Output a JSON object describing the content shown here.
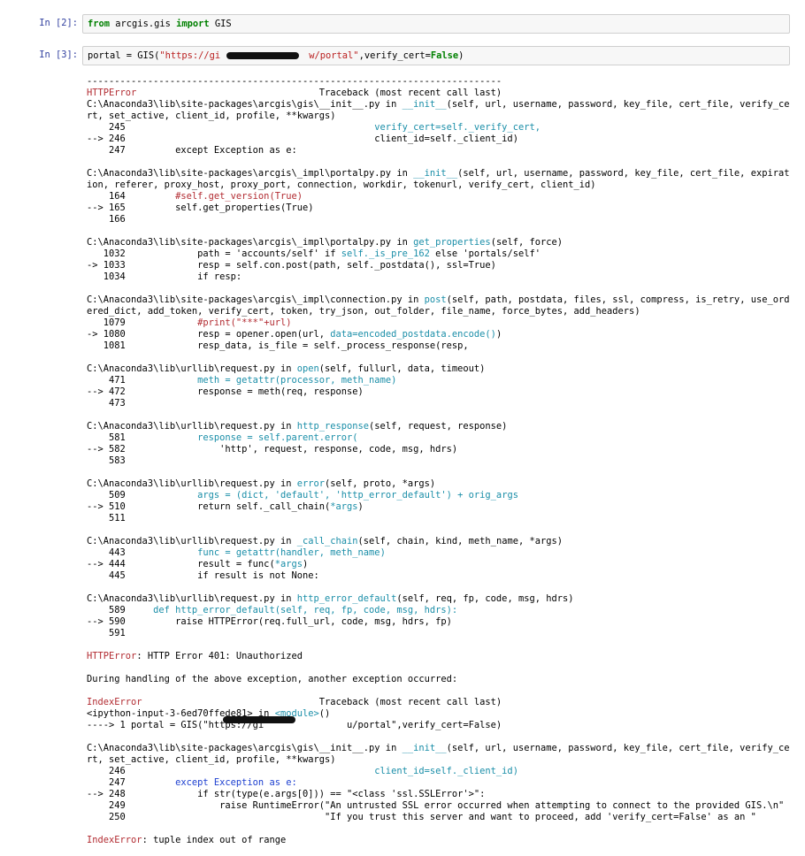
{
  "cells": [
    {
      "prompt": "In [2]:",
      "code_parts": [
        {
          "t": "from",
          "c": "kw"
        },
        {
          "t": " arcgis.gis ",
          "c": ""
        },
        {
          "t": "import",
          "c": "kw"
        },
        {
          "t": " GIS",
          "c": ""
        }
      ]
    },
    {
      "prompt": "In [3]:",
      "code_parts": [
        {
          "t": "portal = GIS(",
          "c": ""
        },
        {
          "t": "\"https://gi",
          "c": "str"
        },
        {
          "t": "                ",
          "c": "str"
        },
        {
          "t": "w/portal\"",
          "c": "str"
        },
        {
          "t": ",verify_cert=",
          "c": ""
        },
        {
          "t": "False",
          "c": "kw"
        },
        {
          "t": ")",
          "c": ""
        }
      ]
    }
  ],
  "output_lines": [
    [
      {
        "t": "---------------------------------------------------------------------------",
        "c": ""
      }
    ],
    [
      {
        "t": "HTTPError",
        "c": "red"
      },
      {
        "t": "                                 Traceback (most recent call last)",
        "c": ""
      }
    ],
    [
      {
        "t": "C:\\Anaconda3\\lib\\site-packages\\arcgis\\gis\\__init__.py in ",
        "c": ""
      },
      {
        "t": "__init__",
        "c": "cyan"
      },
      {
        "t": "(self, url, username, password, key_file, cert_file, verify_ce",
        "c": ""
      }
    ],
    [
      {
        "t": "rt, set_active, client_id, profile, **kwargs)",
        "c": ""
      }
    ],
    [
      {
        "t": "    245                                             ",
        "c": ""
      },
      {
        "t": "verify_cert=self._verify_cert,",
        "c": "cyan"
      }
    ],
    [
      {
        "t": "--> 246                                             client_id=self._client_id)",
        "c": ""
      }
    ],
    [
      {
        "t": "    247         except Exception as e:",
        "c": ""
      }
    ],
    [
      {
        "t": "",
        "c": ""
      }
    ],
    [
      {
        "t": "C:\\Anaconda3\\lib\\site-packages\\arcgis\\_impl\\portalpy.py in ",
        "c": ""
      },
      {
        "t": "__init__",
        "c": "cyan"
      },
      {
        "t": "(self, url, username, password, key_file, cert_file, expirat",
        "c": ""
      }
    ],
    [
      {
        "t": "ion, referer, proxy_host, proxy_port, connection, workdir, tokenurl, verify_cert, client_id)",
        "c": ""
      }
    ],
    [
      {
        "t": "    164         ",
        "c": ""
      },
      {
        "t": "#self.get_version(True)",
        "c": "red"
      }
    ],
    [
      {
        "t": "--> 165         self.get_properties(True)",
        "c": ""
      }
    ],
    [
      {
        "t": "    166",
        "c": ""
      }
    ],
    [
      {
        "t": "",
        "c": ""
      }
    ],
    [
      {
        "t": "C:\\Anaconda3\\lib\\site-packages\\arcgis\\_impl\\portalpy.py in ",
        "c": ""
      },
      {
        "t": "get_properties",
        "c": "cyan"
      },
      {
        "t": "(self, force)",
        "c": ""
      }
    ],
    [
      {
        "t": "   1032             path = 'accounts/self' if ",
        "c": ""
      },
      {
        "t": "self._is_pre_162",
        "c": "cyan"
      },
      {
        "t": " else 'portals/self'",
        "c": ""
      }
    ],
    [
      {
        "t": "-> 1033             resp = self.con.post(path, self._postdata(), ssl=True)",
        "c": ""
      }
    ],
    [
      {
        "t": "   1034             if resp:",
        "c": ""
      }
    ],
    [
      {
        "t": "",
        "c": ""
      }
    ],
    [
      {
        "t": "C:\\Anaconda3\\lib\\site-packages\\arcgis\\_impl\\connection.py in ",
        "c": ""
      },
      {
        "t": "post",
        "c": "cyan"
      },
      {
        "t": "(self, path, postdata, files, ssl, compress, is_retry, use_ord",
        "c": ""
      }
    ],
    [
      {
        "t": "ered_dict, add_token, verify_cert, token, try_json, out_folder, file_name, force_bytes, add_headers)",
        "c": ""
      }
    ],
    [
      {
        "t": "   1079             ",
        "c": ""
      },
      {
        "t": "#print(\"***\"+url)",
        "c": "red"
      }
    ],
    [
      {
        "t": "-> 1080             resp = opener.open(url, ",
        "c": ""
      },
      {
        "t": "data=encoded_postdata.encode()",
        "c": "cyan"
      },
      {
        "t": ")",
        "c": ""
      }
    ],
    [
      {
        "t": "   1081             resp_data, is_file = self._process_response(resp,",
        "c": ""
      }
    ],
    [
      {
        "t": "",
        "c": ""
      }
    ],
    [
      {
        "t": "C:\\Anaconda3\\lib\\urllib\\request.py in ",
        "c": ""
      },
      {
        "t": "open",
        "c": "cyan"
      },
      {
        "t": "(self, fullurl, data, timeout)",
        "c": ""
      }
    ],
    [
      {
        "t": "    471             ",
        "c": ""
      },
      {
        "t": "meth = getattr(processor, meth_name)",
        "c": "cyan"
      }
    ],
    [
      {
        "t": "--> 472             response = meth(req, response)",
        "c": ""
      }
    ],
    [
      {
        "t": "    473",
        "c": ""
      }
    ],
    [
      {
        "t": "",
        "c": ""
      }
    ],
    [
      {
        "t": "C:\\Anaconda3\\lib\\urllib\\request.py in ",
        "c": ""
      },
      {
        "t": "http_response",
        "c": "cyan"
      },
      {
        "t": "(self, request, response)",
        "c": ""
      }
    ],
    [
      {
        "t": "    581             ",
        "c": ""
      },
      {
        "t": "response = self.parent.error(",
        "c": "cyan"
      }
    ],
    [
      {
        "t": "--> 582                 'http', request, response, code, msg, hdrs)",
        "c": ""
      }
    ],
    [
      {
        "t": "    583",
        "c": ""
      }
    ],
    [
      {
        "t": "",
        "c": ""
      }
    ],
    [
      {
        "t": "C:\\Anaconda3\\lib\\urllib\\request.py in ",
        "c": ""
      },
      {
        "t": "error",
        "c": "cyan"
      },
      {
        "t": "(self, proto, *args)",
        "c": ""
      }
    ],
    [
      {
        "t": "    509             ",
        "c": ""
      },
      {
        "t": "args = (dict, 'default', 'http_error_default') + orig_args",
        "c": "cyan"
      }
    ],
    [
      {
        "t": "--> 510             return self._call_chain(",
        "c": ""
      },
      {
        "t": "*args",
        "c": "cyan"
      },
      {
        "t": ")",
        "c": ""
      }
    ],
    [
      {
        "t": "    511",
        "c": ""
      }
    ],
    [
      {
        "t": "",
        "c": ""
      }
    ],
    [
      {
        "t": "C:\\Anaconda3\\lib\\urllib\\request.py in ",
        "c": ""
      },
      {
        "t": "_call_chain",
        "c": "cyan"
      },
      {
        "t": "(self, chain, kind, meth_name, *args)",
        "c": ""
      }
    ],
    [
      {
        "t": "    443             ",
        "c": ""
      },
      {
        "t": "func = getattr(handler, meth_name)",
        "c": "cyan"
      }
    ],
    [
      {
        "t": "--> 444             result = func(",
        "c": ""
      },
      {
        "t": "*args",
        "c": "cyan"
      },
      {
        "t": ")",
        "c": ""
      }
    ],
    [
      {
        "t": "    445             if result is not None:",
        "c": ""
      }
    ],
    [
      {
        "t": "",
        "c": ""
      }
    ],
    [
      {
        "t": "C:\\Anaconda3\\lib\\urllib\\request.py in ",
        "c": ""
      },
      {
        "t": "http_error_default",
        "c": "cyan"
      },
      {
        "t": "(self, req, fp, code, msg, hdrs)",
        "c": ""
      }
    ],
    [
      {
        "t": "    589     ",
        "c": ""
      },
      {
        "t": "def http_error_default(self, req, fp, code, msg, hdrs):",
        "c": "cyan"
      }
    ],
    [
      {
        "t": "--> 590         raise HTTPError(req.full_url, code, msg, hdrs, fp)",
        "c": ""
      }
    ],
    [
      {
        "t": "    591",
        "c": ""
      }
    ],
    [
      {
        "t": "",
        "c": ""
      }
    ],
    [
      {
        "t": "HTTPError",
        "c": "red"
      },
      {
        "t": ": HTTP Error 401: Unauthorized",
        "c": ""
      }
    ],
    [
      {
        "t": "",
        "c": ""
      }
    ],
    [
      {
        "t": "During handling of the above exception, another exception occurred:",
        "c": ""
      }
    ],
    [
      {
        "t": "",
        "c": ""
      }
    ],
    [
      {
        "t": "IndexError",
        "c": "red"
      },
      {
        "t": "                                Traceback (most recent call last)",
        "c": ""
      }
    ],
    [
      {
        "t": "<ipython-input-3-6ed70ffede81> in ",
        "c": ""
      },
      {
        "t": "<module>",
        "c": "cyan"
      },
      {
        "t": "()",
        "c": ""
      }
    ],
    [
      {
        "t": "----> 1 portal = GIS(\"https://gi",
        "c": ""
      },
      {
        "t": "               ",
        "c": ""
      },
      {
        "t": "u/portal\",verify_cert=False)",
        "c": ""
      }
    ],
    [
      {
        "t": "",
        "c": ""
      }
    ],
    [
      {
        "t": "C:\\Anaconda3\\lib\\site-packages\\arcgis\\gis\\__init__.py in ",
        "c": ""
      },
      {
        "t": "__init__",
        "c": "cyan"
      },
      {
        "t": "(self, url, username, password, key_file, cert_file, verify_ce",
        "c": ""
      }
    ],
    [
      {
        "t": "rt, set_active, client_id, profile, **kwargs)",
        "c": ""
      }
    ],
    [
      {
        "t": "    246                                             ",
        "c": ""
      },
      {
        "t": "client_id=self._client_id)",
        "c": "cyan"
      }
    ],
    [
      {
        "t": "    247         ",
        "c": ""
      },
      {
        "t": "except Exception as e:",
        "c": "blue"
      }
    ],
    [
      {
        "t": "--> 248             if str(type(e.args[0])) == \"<class 'ssl.SSLError'>\":",
        "c": ""
      }
    ],
    [
      {
        "t": "    249                 raise RuntimeError(\"An untrusted SSL error occurred when attempting to connect to the provided GIS.\\n\"",
        "c": ""
      }
    ],
    [
      {
        "t": "    250                                    \"If you trust this server and want to proceed, add 'verify_cert=False' as an \"",
        "c": ""
      }
    ],
    [
      {
        "t": "",
        "c": ""
      }
    ],
    [
      {
        "t": "IndexError",
        "c": "red"
      },
      {
        "t": ": tuple index out of range",
        "c": ""
      }
    ]
  ]
}
